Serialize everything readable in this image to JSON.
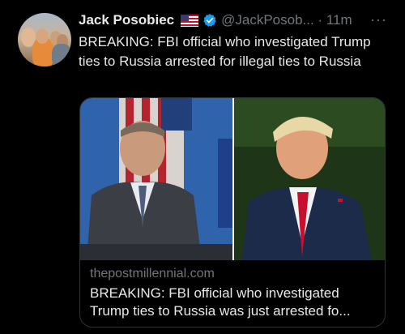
{
  "tweet": {
    "author_name": "Jack Posobiec",
    "handle_time": "@JackPosob... · 11m",
    "more_icon": "more-horizontal-icon",
    "flag_icon": "us-flag-icon",
    "verified_icon": "verified-badge-icon",
    "text": "BREAKING: FBI official who investigated Trump ties to Russia arrested for illegal ties to Russia"
  },
  "card": {
    "domain": "thepostmillennial.com",
    "title": "BREAKING: FBI official who investigated Trump ties to Russia was just arrested fo..."
  },
  "colors": {
    "background": "#000000",
    "text_primary": "#e7e9ea",
    "text_secondary": "#71767b",
    "verified": "#1d9bf0",
    "border": "#2f3336"
  }
}
